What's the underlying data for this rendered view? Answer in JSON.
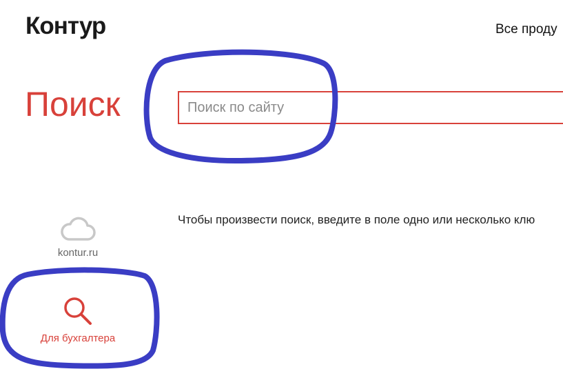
{
  "header": {
    "logo": "Контур",
    "nav_label": "Все проду"
  },
  "search": {
    "title": "Поиск",
    "placeholder": "Поиск по сайту",
    "hint": "Чтобы произвести поиск, введите в поле одно или несколько клю"
  },
  "sidebar": {
    "items": [
      {
        "label": "kontur.ru",
        "icon": "cloud-icon"
      },
      {
        "label": "Для бухгалтера",
        "icon": "search-icon"
      }
    ]
  },
  "colors": {
    "accent": "#d8413a",
    "annotation": "#3a3dc4",
    "muted_icon": "#c8c8c8"
  }
}
